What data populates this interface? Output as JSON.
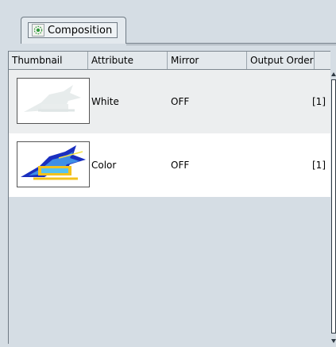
{
  "tab": {
    "label": "Composition",
    "icon": "composition-icon"
  },
  "table": {
    "columns": [
      "Thumbnail",
      "Attribute",
      "Mirror",
      "Output Order"
    ],
    "rows": [
      {
        "thumbnail": "white-thumbnail",
        "attribute": "White",
        "mirror": "OFF",
        "output_order": "[1]"
      },
      {
        "thumbnail": "color-thumbnail",
        "attribute": "Color",
        "mirror": "OFF",
        "output_order": "[1]"
      }
    ]
  },
  "colors": {
    "background": "#d5dde4",
    "header": "#e3e8ec",
    "row_selected": "#eceeef",
    "row": "#ffffff"
  }
}
